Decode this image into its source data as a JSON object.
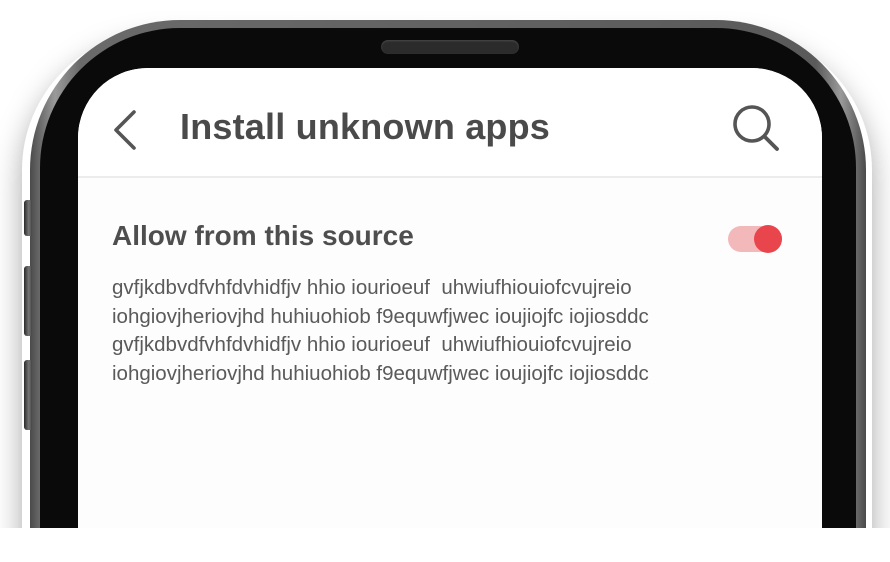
{
  "app_bar": {
    "title": "Install unknown apps",
    "back_icon": "chevron-left-icon",
    "search_icon": "search-icon"
  },
  "setting": {
    "label": "Allow from this source",
    "toggle_state": "on",
    "toggle_track_color": "#f2b8ba",
    "toggle_thumb_color": "#e8464c"
  },
  "description": {
    "lines": [
      "gvfjkdbvdfvhfdvhidfjv hhio iourioeuf  uhwiufhiouiofcvujreio",
      "iohgiovjheriovjhd huhiuohiob f9equwfjwec ioujiojfc iojiosddc",
      "gvfjkdbvdfvhfdvhidfjv hhio iourioeuf  uhwiufhiouiofcvujreio",
      "iohgiovjheriovjhd huhiuohiob f9equwfjwec ioujiojfc iojiosddc"
    ]
  }
}
